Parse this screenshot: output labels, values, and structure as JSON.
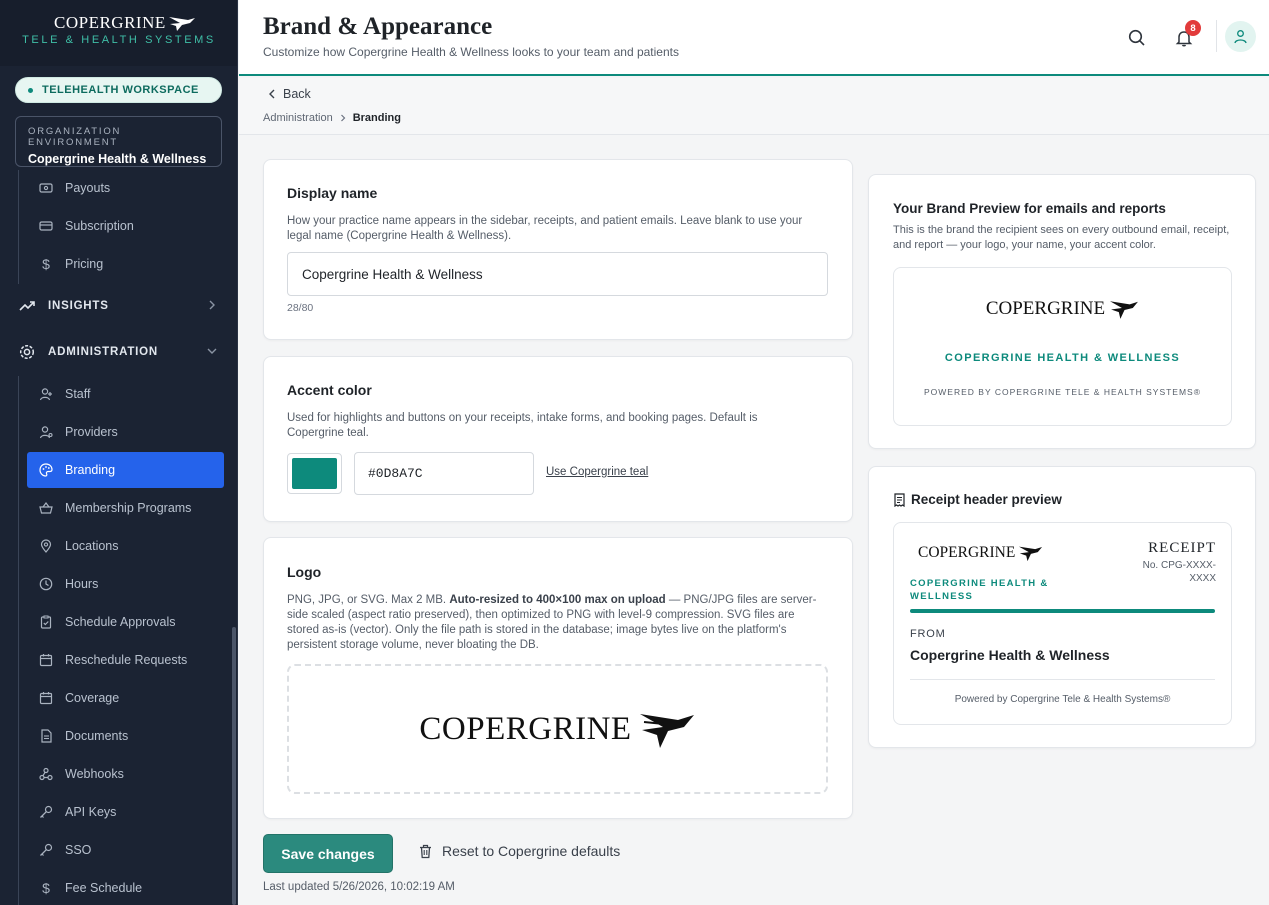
{
  "sidebar": {
    "brand_name": "COPERGRINE",
    "brand_tagline": "TELE & HEALTH SYSTEMS",
    "workspace_label": "TELEHEALTH WORKSPACE",
    "org_label": "ORGANIZATION ENVIRONMENT",
    "org_name": "Copergrine Health & Wellness",
    "billing_items": [
      {
        "label": "Payouts",
        "icon": "payouts-icon"
      },
      {
        "label": "Subscription",
        "icon": "card-icon"
      },
      {
        "label": "Pricing",
        "icon": "dollar-icon"
      }
    ],
    "insights_label": "INSIGHTS",
    "admin_label": "ADMINISTRATION",
    "admin_items": [
      {
        "label": "Staff",
        "icon": "user-icon"
      },
      {
        "label": "Providers",
        "icon": "provider-icon"
      },
      {
        "label": "Branding",
        "icon": "palette-icon",
        "active": true
      },
      {
        "label": "Membership Programs",
        "icon": "basket-icon"
      },
      {
        "label": "Locations",
        "icon": "pin-icon"
      },
      {
        "label": "Hours",
        "icon": "clock-icon"
      },
      {
        "label": "Schedule Approvals",
        "icon": "clipboard-check-icon"
      },
      {
        "label": "Reschedule Requests",
        "icon": "calendar-icon"
      },
      {
        "label": "Coverage",
        "icon": "calendar-icon"
      },
      {
        "label": "Documents",
        "icon": "document-icon"
      },
      {
        "label": "Webhooks",
        "icon": "webhook-icon"
      },
      {
        "label": "API Keys",
        "icon": "key-icon"
      },
      {
        "label": "SSO",
        "icon": "key-icon"
      },
      {
        "label": "Fee Schedule",
        "icon": "dollar-icon"
      }
    ]
  },
  "header": {
    "title": "Brand & Appearance",
    "subtitle": "Customize how Copergrine Health & Wellness looks to your team and patients",
    "notification_count": "8"
  },
  "subheader": {
    "back_label": "Back",
    "breadcrumb_root": "Administration",
    "breadcrumb_current": "Branding"
  },
  "display_name": {
    "title": "Display name",
    "description": "How your practice name appears in the sidebar, receipts, and patient emails. Leave blank to use your legal name (Copergrine Health & Wellness).",
    "value": "Copergrine Health & Wellness",
    "counter": "28/80"
  },
  "accent": {
    "title": "Accent color",
    "description": "Used for highlights and buttons on your receipts, intake forms, and booking pages. Default is Copergrine teal.",
    "hex": "#0D8A7C",
    "color": "#0d8a7c",
    "reset_link": "Use Copergrine teal"
  },
  "logo": {
    "title": "Logo",
    "desc_a": "PNG, JPG, or SVG. Max 2 MB. ",
    "desc_bold": "Auto-resized to 400×100 max on upload",
    "desc_b": " — PNG/JPG files are server-side scaled (aspect ratio preserved), then optimized to PNG with level-9 compression. SVG files are stored as-is (vector). Only the file path is stored in the database; image bytes live on the platform's persistent storage volume, never bloating the DB.",
    "wordmark": "COPERGRINE"
  },
  "actions": {
    "save_label": "Save changes",
    "reset_label": "Reset to Copergrine defaults",
    "last_updated": "Last updated 5/26/2026, 10:02:19 AM"
  },
  "brand_preview": {
    "title": "Your Brand Preview for emails and reports",
    "description": "This is the brand the recipient sees on every outbound email, receipt, and report — your logo, your name, your accent color.",
    "wordmark": "COPERGRINE",
    "org_name": "COPERGRINE HEALTH & WELLNESS",
    "powered": "POWERED BY COPERGRINE TELE & HEALTH SYSTEMS®"
  },
  "receipt_preview": {
    "title": "Receipt header preview",
    "wordmark": "COPERGRINE",
    "org_name_line1": "COPERGRINE HEALTH &",
    "org_name_line2": "WELLNESS",
    "receipt_label": "RECEIPT",
    "receipt_no_line1": "No. CPG-XXXX-",
    "receipt_no_line2": "XXXX",
    "from_label": "FROM",
    "from_name": "Copergrine Health & Wellness",
    "powered": "Powered by Copergrine Tele & Health Systems®"
  }
}
